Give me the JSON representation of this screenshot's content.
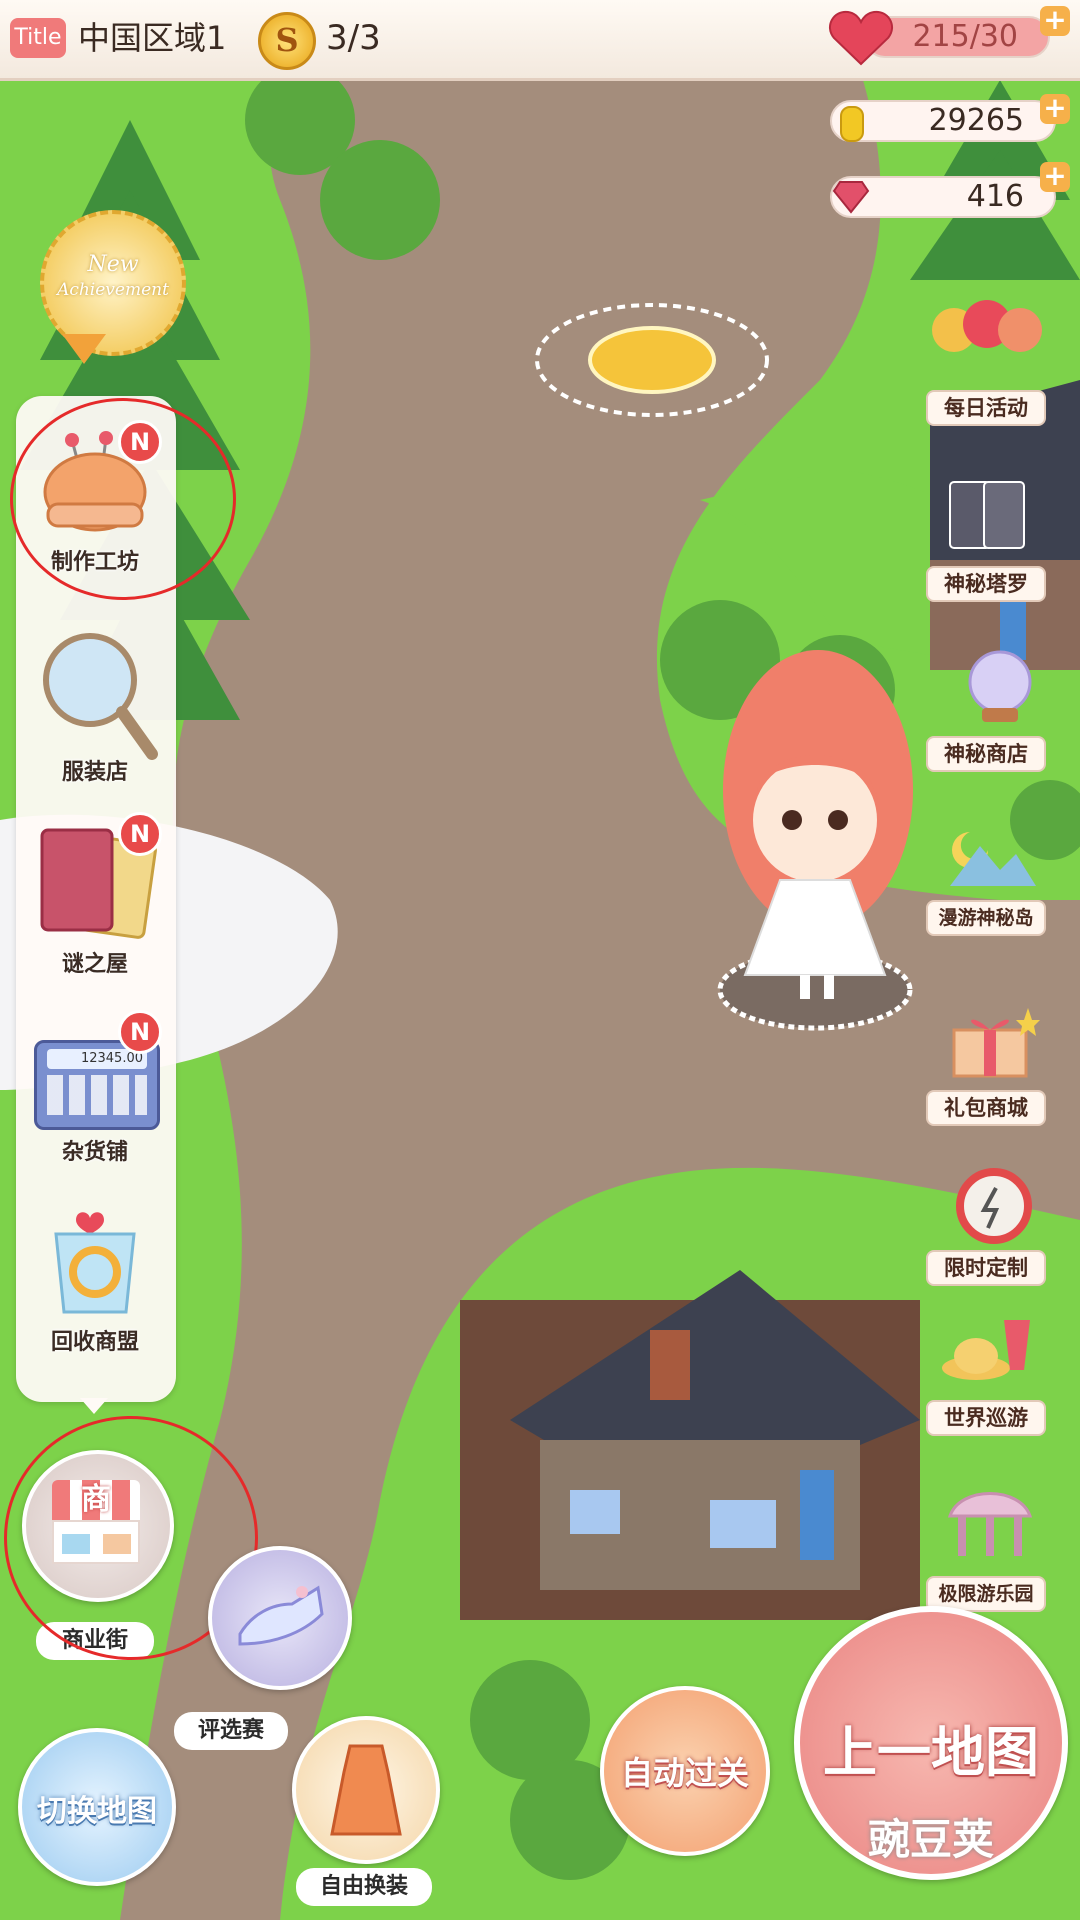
{
  "top_bar": {
    "title_badge": "Title",
    "region": "中国区域1",
    "coin_symbol": "S",
    "coin_count": "3/3",
    "hp": "215/30",
    "gold": "29265",
    "diamond": "416",
    "plus": "+"
  },
  "achievement": {
    "line1": "New",
    "line2": "Achievement"
  },
  "left_menu": {
    "items": [
      {
        "label": "制作工坊",
        "badge": "N",
        "icon": "pincushion-icon"
      },
      {
        "label": "服装店",
        "badge": "",
        "icon": "mirror-icon"
      },
      {
        "label": "谜之屋",
        "badge": "N",
        "icon": "cards-icon"
      },
      {
        "label": "杂货铺",
        "badge": "N",
        "icon": "calculator-icon"
      },
      {
        "label": "回收商盟",
        "badge": "",
        "icon": "recycle-bin-icon"
      }
    ],
    "calculator_display": "12345.00"
  },
  "right_menu": {
    "items": [
      {
        "label": "每日活动",
        "icon": "balloons-icon"
      },
      {
        "label": "神秘塔罗",
        "icon": "tarot-icon"
      },
      {
        "label": "神秘商店",
        "icon": "crystal-ball-icon"
      },
      {
        "label": "漫游神秘岛",
        "icon": "island-icon"
      },
      {
        "label": "礼包商城",
        "icon": "gift-icon"
      },
      {
        "label": "限时定制",
        "icon": "alarm-clock-icon"
      },
      {
        "label": "世界巡游",
        "icon": "hat-shoes-icon"
      },
      {
        "label": "极限游乐园",
        "icon": "carousel-icon"
      }
    ]
  },
  "bottom": {
    "shop_char": "商",
    "commerce_street": "商业街",
    "contest": "评选赛",
    "switch_map": "切换地图",
    "free_dress": "自由换装",
    "auto_pass": "自动过关",
    "prev_map": "上一地图",
    "watermark": "豌豆荚"
  },
  "colors": {
    "grass": "#7dd24a",
    "path": "#a48d7c",
    "accent_red": "#e84a4a",
    "annotation_red": "#e52a2a"
  }
}
